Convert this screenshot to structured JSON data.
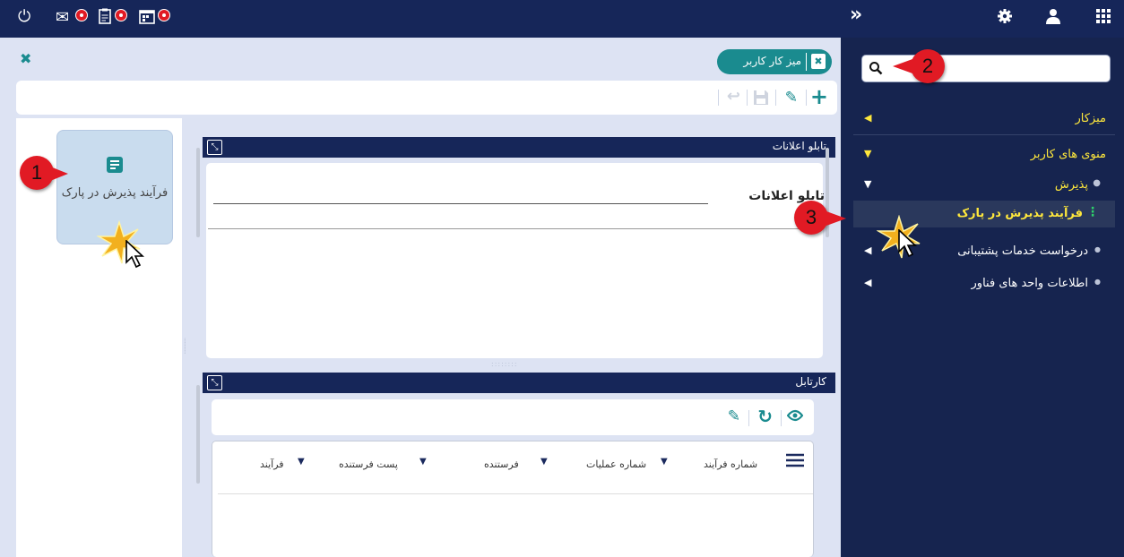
{
  "sidebar": {
    "search_placeholder": "",
    "items": [
      {
        "label": "میزکار",
        "arrow": "◀"
      },
      {
        "label": "منوی های کاربر",
        "arrow": "▼"
      },
      {
        "label": "پذیرش",
        "arrow": "▼"
      },
      {
        "label": "فرآیند پذیرش در پارک"
      },
      {
        "label": "درخواست خدمات پشتیبانی",
        "arrow": "◀"
      },
      {
        "label": "اطلاعات واحد های فناور",
        "arrow": "◀"
      }
    ]
  },
  "tab": {
    "label": "میز کار کاربر"
  },
  "tile": {
    "label": "فرآیند پذیرش در پارک"
  },
  "bulletin": {
    "header": "تابلو اعلانات",
    "title": "تابلو اعلانات"
  },
  "kartable": {
    "header": "کارتابل",
    "columns": [
      "شماره فرآیند",
      "شماره عملیات",
      "فرستنده",
      "پست فرستنده",
      "فرآیند"
    ]
  },
  "callouts": [
    "1",
    "2",
    "3"
  ],
  "colors": {
    "topbar": "#162659",
    "sidebar": "#16244f",
    "accent": "#ffe83c",
    "tab": "#1a8b8f",
    "badge": "#e11a24"
  }
}
